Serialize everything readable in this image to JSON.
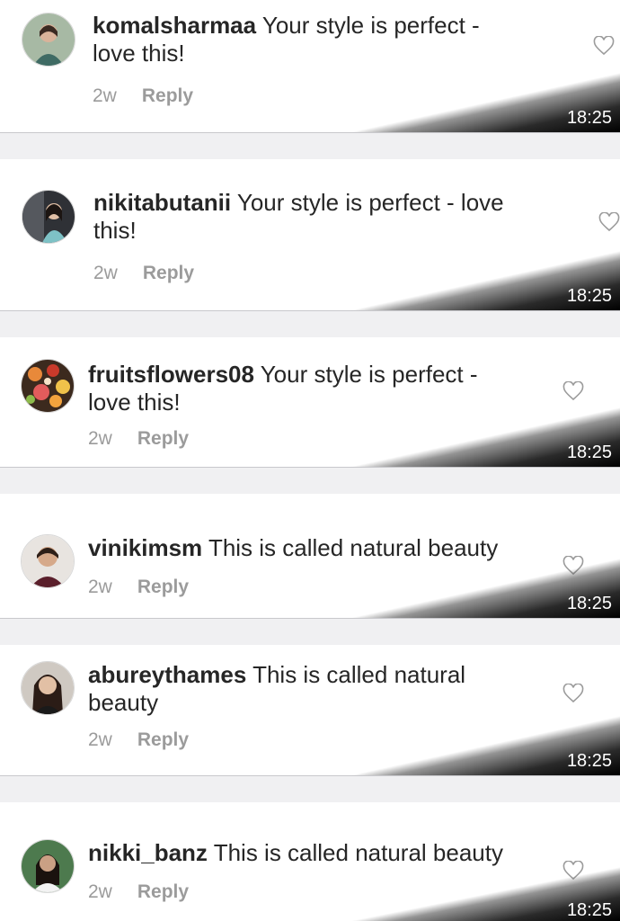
{
  "comments": [
    {
      "username": "komalsharmaa",
      "text": "Your style is perfect - love this!",
      "age": "2w",
      "reply_label": "Reply",
      "timestamp": "18:25",
      "avatar_icon": "user-avatar-icon",
      "like_icon": "heart-outline-icon"
    },
    {
      "username": "nikitabutanii",
      "text": "Your style is perfect - love this!",
      "age": "2w",
      "reply_label": "Reply",
      "timestamp": "18:25",
      "avatar_icon": "user-avatar-icon",
      "like_icon": "heart-outline-icon"
    },
    {
      "username": "fruitsflowers08",
      "text": "Your style is perfect - love this!",
      "age": "2w",
      "reply_label": "Reply",
      "timestamp": "18:25",
      "avatar_icon": "user-avatar-icon",
      "like_icon": "heart-outline-icon"
    },
    {
      "username": "vinikimsm",
      "text": "This is called natural beauty",
      "age": "2w",
      "reply_label": "Reply",
      "timestamp": "18:25",
      "avatar_icon": "user-avatar-icon",
      "like_icon": "heart-outline-icon"
    },
    {
      "username": "abureythames",
      "text": "This is called natural beauty",
      "age": "2w",
      "reply_label": "Reply",
      "timestamp": "18:25",
      "avatar_icon": "user-avatar-icon",
      "like_icon": "heart-outline-icon"
    },
    {
      "username": "nikki_banz",
      "text": "This is called natural beauty",
      "age": "2w",
      "reply_label": "Reply",
      "timestamp": "18:25",
      "avatar_icon": "user-avatar-icon",
      "like_icon": "heart-outline-icon"
    }
  ],
  "colors": {
    "background": "#f0f0f2",
    "card": "#ffffff",
    "text": "#262626",
    "muted": "#9b9b9b",
    "timestamp": "#ffffff"
  }
}
